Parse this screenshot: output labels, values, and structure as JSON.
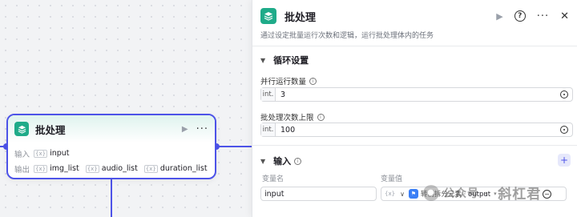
{
  "node": {
    "title": "批处理",
    "input_label": "输入",
    "output_label": "输出",
    "input_var": "input",
    "outputs": [
      "img_list",
      "audio_list",
      "duration_list"
    ],
    "var_icon": "{x}"
  },
  "panel": {
    "title": "批处理",
    "description": "通过设定批量运行次数和逻辑，运行批处理体内的任务",
    "loop_section": {
      "title": "循环设置",
      "parallel_label": "并行运行数量",
      "parallel_type": "int.",
      "parallel_value": "3",
      "max_label": "批处理次数上限",
      "max_type": "int.",
      "max_value": "100"
    },
    "input_section": {
      "title": "输入",
      "col_name": "变量名",
      "col_value": "变量值",
      "row_name": "input",
      "row_ref_prefix": "拆分",
      "row_ref_source": "转创拆分元素",
      "row_ref_output": "output"
    }
  },
  "watermark": {
    "channel": "公众号 ·",
    "name": "斜杠君"
  },
  "colors": {
    "accent": "#4d53e8",
    "app_icon": "#1fab89"
  },
  "icons": [
    "batch-app-icon",
    "run-icon",
    "more-icon",
    "help-icon",
    "close-icon",
    "chevron-down-icon",
    "info-icon",
    "clock-icon",
    "plus-icon",
    "remove-icon"
  ]
}
